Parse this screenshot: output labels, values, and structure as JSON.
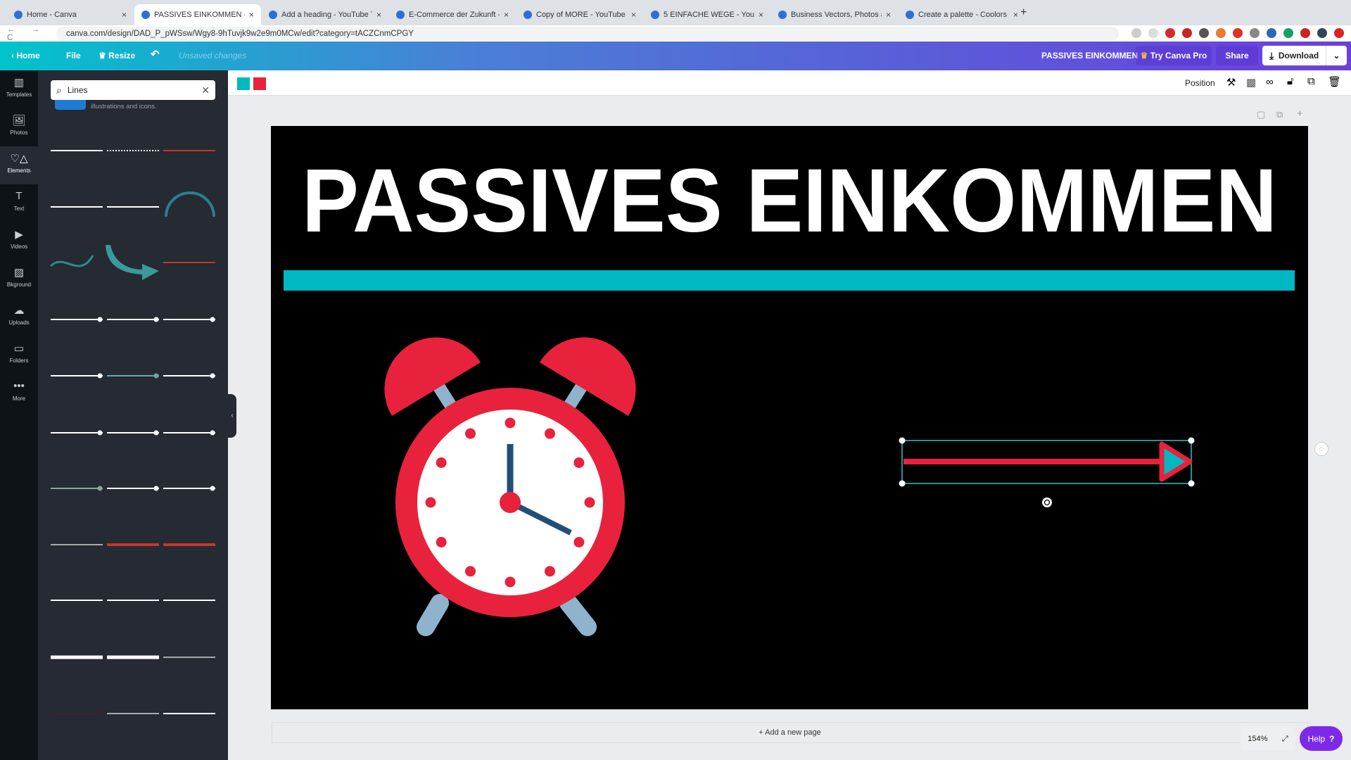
{
  "browser": {
    "tabs": [
      {
        "title": "Home - Canva",
        "active": false
      },
      {
        "title": "PASSIVES EINKOMMEN - YouT",
        "active": true
      },
      {
        "title": "Add a heading - YouTube Thum",
        "active": false
      },
      {
        "title": "E-Commerce der Zukunft - You",
        "active": false
      },
      {
        "title": "Copy of MORE - YouTube Thum",
        "active": false
      },
      {
        "title": "5 EINFACHE WEGE - YouTube",
        "active": false
      },
      {
        "title": "Business Vectors, Photos and",
        "active": false
      },
      {
        "title": "Create a palette - Coolors",
        "active": false
      }
    ],
    "close_label": "×",
    "new_tab_label": "+",
    "url": "canva.com/design/DAD_P_pWSsw/Wgy8-9hTuvjk9w2e9m0MCw/edit?category=tACZCnmCPGY",
    "nav": "← → C"
  },
  "header": {
    "home": "Home",
    "file": "File",
    "resize": "Resize",
    "unsaved": "Unsaved changes",
    "design_title": "PASSIVES EINKOMMEN",
    "try_pro": "Try Canva Pro",
    "share": "Share",
    "download": "Download"
  },
  "toolbar": {
    "colors": [
      "#00b8c2",
      "#e8223d"
    ],
    "position": "Position"
  },
  "rail": [
    {
      "label": "Templates",
      "icon": "▥"
    },
    {
      "label": "Photos",
      "icon": "🖼"
    },
    {
      "label": "Elements",
      "icon": "♡△"
    },
    {
      "label": "Text",
      "icon": "T"
    },
    {
      "label": "Videos",
      "icon": "▶"
    },
    {
      "label": "Bkground",
      "icon": "▨"
    },
    {
      "label": "Uploads",
      "icon": "☁"
    },
    {
      "label": "Folders",
      "icon": "▭"
    },
    {
      "label": "More",
      "icon": "•••"
    }
  ],
  "panel": {
    "search_value": "Lines",
    "promo_text": "illustrations and icons."
  },
  "design": {
    "title": "PASSIVES EINKOMMEN",
    "colors": {
      "teal": "#00b8c2",
      "red": "#e8223d",
      "background": "#000000",
      "face": "#ffffff",
      "hands": "#1f4e79",
      "legs": "#8fb3cc"
    }
  },
  "canvas": {
    "add_page": "+ Add a new page",
    "zoom": "154%",
    "help": "Help",
    "help_icon": "?"
  }
}
